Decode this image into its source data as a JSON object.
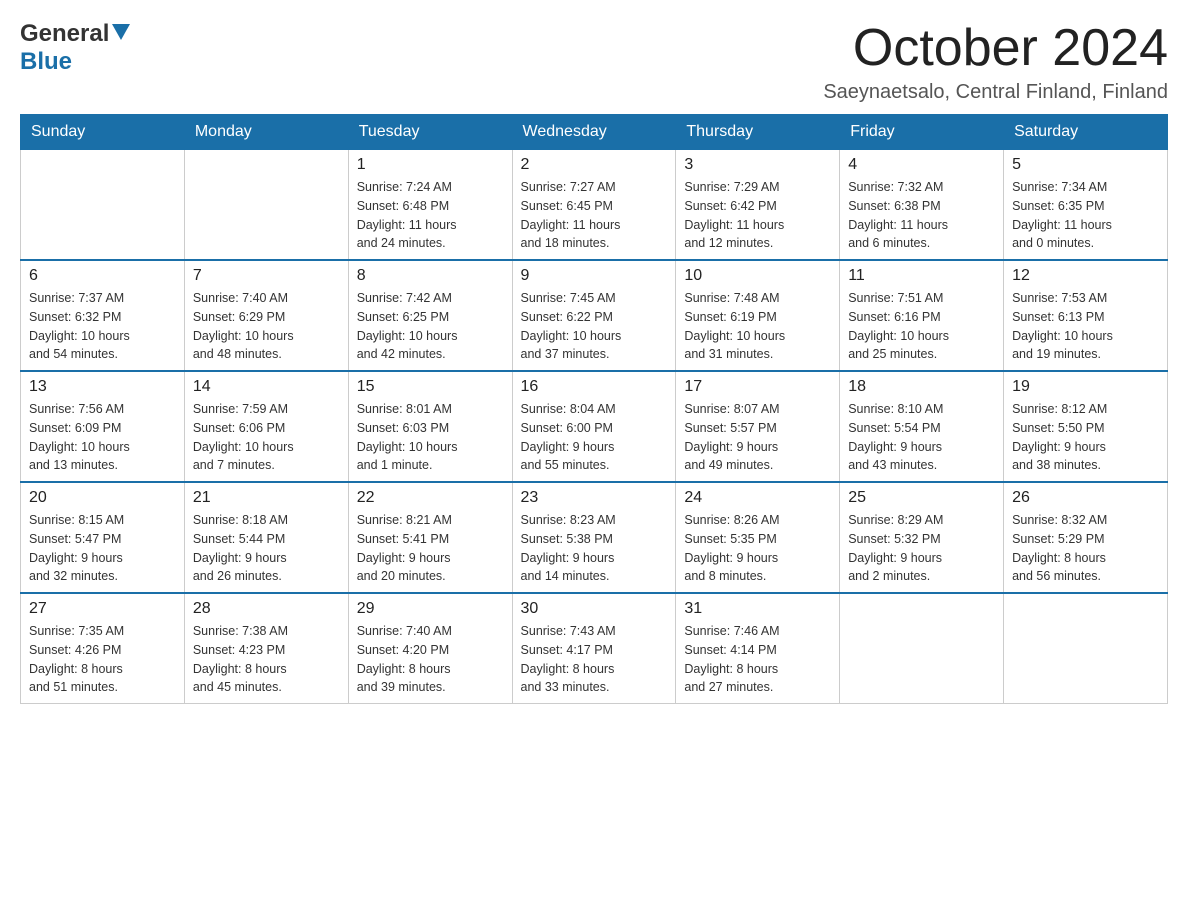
{
  "header": {
    "logo": {
      "general": "General",
      "blue": "Blue"
    },
    "title": "October 2024",
    "location": "Saeynaetsalo, Central Finland, Finland"
  },
  "days_of_week": [
    "Sunday",
    "Monday",
    "Tuesday",
    "Wednesday",
    "Thursday",
    "Friday",
    "Saturday"
  ],
  "weeks": [
    [
      {
        "day": "",
        "info": ""
      },
      {
        "day": "",
        "info": ""
      },
      {
        "day": "1",
        "info": "Sunrise: 7:24 AM\nSunset: 6:48 PM\nDaylight: 11 hours\nand 24 minutes."
      },
      {
        "day": "2",
        "info": "Sunrise: 7:27 AM\nSunset: 6:45 PM\nDaylight: 11 hours\nand 18 minutes."
      },
      {
        "day": "3",
        "info": "Sunrise: 7:29 AM\nSunset: 6:42 PM\nDaylight: 11 hours\nand 12 minutes."
      },
      {
        "day": "4",
        "info": "Sunrise: 7:32 AM\nSunset: 6:38 PM\nDaylight: 11 hours\nand 6 minutes."
      },
      {
        "day": "5",
        "info": "Sunrise: 7:34 AM\nSunset: 6:35 PM\nDaylight: 11 hours\nand 0 minutes."
      }
    ],
    [
      {
        "day": "6",
        "info": "Sunrise: 7:37 AM\nSunset: 6:32 PM\nDaylight: 10 hours\nand 54 minutes."
      },
      {
        "day": "7",
        "info": "Sunrise: 7:40 AM\nSunset: 6:29 PM\nDaylight: 10 hours\nand 48 minutes."
      },
      {
        "day": "8",
        "info": "Sunrise: 7:42 AM\nSunset: 6:25 PM\nDaylight: 10 hours\nand 42 minutes."
      },
      {
        "day": "9",
        "info": "Sunrise: 7:45 AM\nSunset: 6:22 PM\nDaylight: 10 hours\nand 37 minutes."
      },
      {
        "day": "10",
        "info": "Sunrise: 7:48 AM\nSunset: 6:19 PM\nDaylight: 10 hours\nand 31 minutes."
      },
      {
        "day": "11",
        "info": "Sunrise: 7:51 AM\nSunset: 6:16 PM\nDaylight: 10 hours\nand 25 minutes."
      },
      {
        "day": "12",
        "info": "Sunrise: 7:53 AM\nSunset: 6:13 PM\nDaylight: 10 hours\nand 19 minutes."
      }
    ],
    [
      {
        "day": "13",
        "info": "Sunrise: 7:56 AM\nSunset: 6:09 PM\nDaylight: 10 hours\nand 13 minutes."
      },
      {
        "day": "14",
        "info": "Sunrise: 7:59 AM\nSunset: 6:06 PM\nDaylight: 10 hours\nand 7 minutes."
      },
      {
        "day": "15",
        "info": "Sunrise: 8:01 AM\nSunset: 6:03 PM\nDaylight: 10 hours\nand 1 minute."
      },
      {
        "day": "16",
        "info": "Sunrise: 8:04 AM\nSunset: 6:00 PM\nDaylight: 9 hours\nand 55 minutes."
      },
      {
        "day": "17",
        "info": "Sunrise: 8:07 AM\nSunset: 5:57 PM\nDaylight: 9 hours\nand 49 minutes."
      },
      {
        "day": "18",
        "info": "Sunrise: 8:10 AM\nSunset: 5:54 PM\nDaylight: 9 hours\nand 43 minutes."
      },
      {
        "day": "19",
        "info": "Sunrise: 8:12 AM\nSunset: 5:50 PM\nDaylight: 9 hours\nand 38 minutes."
      }
    ],
    [
      {
        "day": "20",
        "info": "Sunrise: 8:15 AM\nSunset: 5:47 PM\nDaylight: 9 hours\nand 32 minutes."
      },
      {
        "day": "21",
        "info": "Sunrise: 8:18 AM\nSunset: 5:44 PM\nDaylight: 9 hours\nand 26 minutes."
      },
      {
        "day": "22",
        "info": "Sunrise: 8:21 AM\nSunset: 5:41 PM\nDaylight: 9 hours\nand 20 minutes."
      },
      {
        "day": "23",
        "info": "Sunrise: 8:23 AM\nSunset: 5:38 PM\nDaylight: 9 hours\nand 14 minutes."
      },
      {
        "day": "24",
        "info": "Sunrise: 8:26 AM\nSunset: 5:35 PM\nDaylight: 9 hours\nand 8 minutes."
      },
      {
        "day": "25",
        "info": "Sunrise: 8:29 AM\nSunset: 5:32 PM\nDaylight: 9 hours\nand 2 minutes."
      },
      {
        "day": "26",
        "info": "Sunrise: 8:32 AM\nSunset: 5:29 PM\nDaylight: 8 hours\nand 56 minutes."
      }
    ],
    [
      {
        "day": "27",
        "info": "Sunrise: 7:35 AM\nSunset: 4:26 PM\nDaylight: 8 hours\nand 51 minutes."
      },
      {
        "day": "28",
        "info": "Sunrise: 7:38 AM\nSunset: 4:23 PM\nDaylight: 8 hours\nand 45 minutes."
      },
      {
        "day": "29",
        "info": "Sunrise: 7:40 AM\nSunset: 4:20 PM\nDaylight: 8 hours\nand 39 minutes."
      },
      {
        "day": "30",
        "info": "Sunrise: 7:43 AM\nSunset: 4:17 PM\nDaylight: 8 hours\nand 33 minutes."
      },
      {
        "day": "31",
        "info": "Sunrise: 7:46 AM\nSunset: 4:14 PM\nDaylight: 8 hours\nand 27 minutes."
      },
      {
        "day": "",
        "info": ""
      },
      {
        "day": "",
        "info": ""
      }
    ]
  ]
}
